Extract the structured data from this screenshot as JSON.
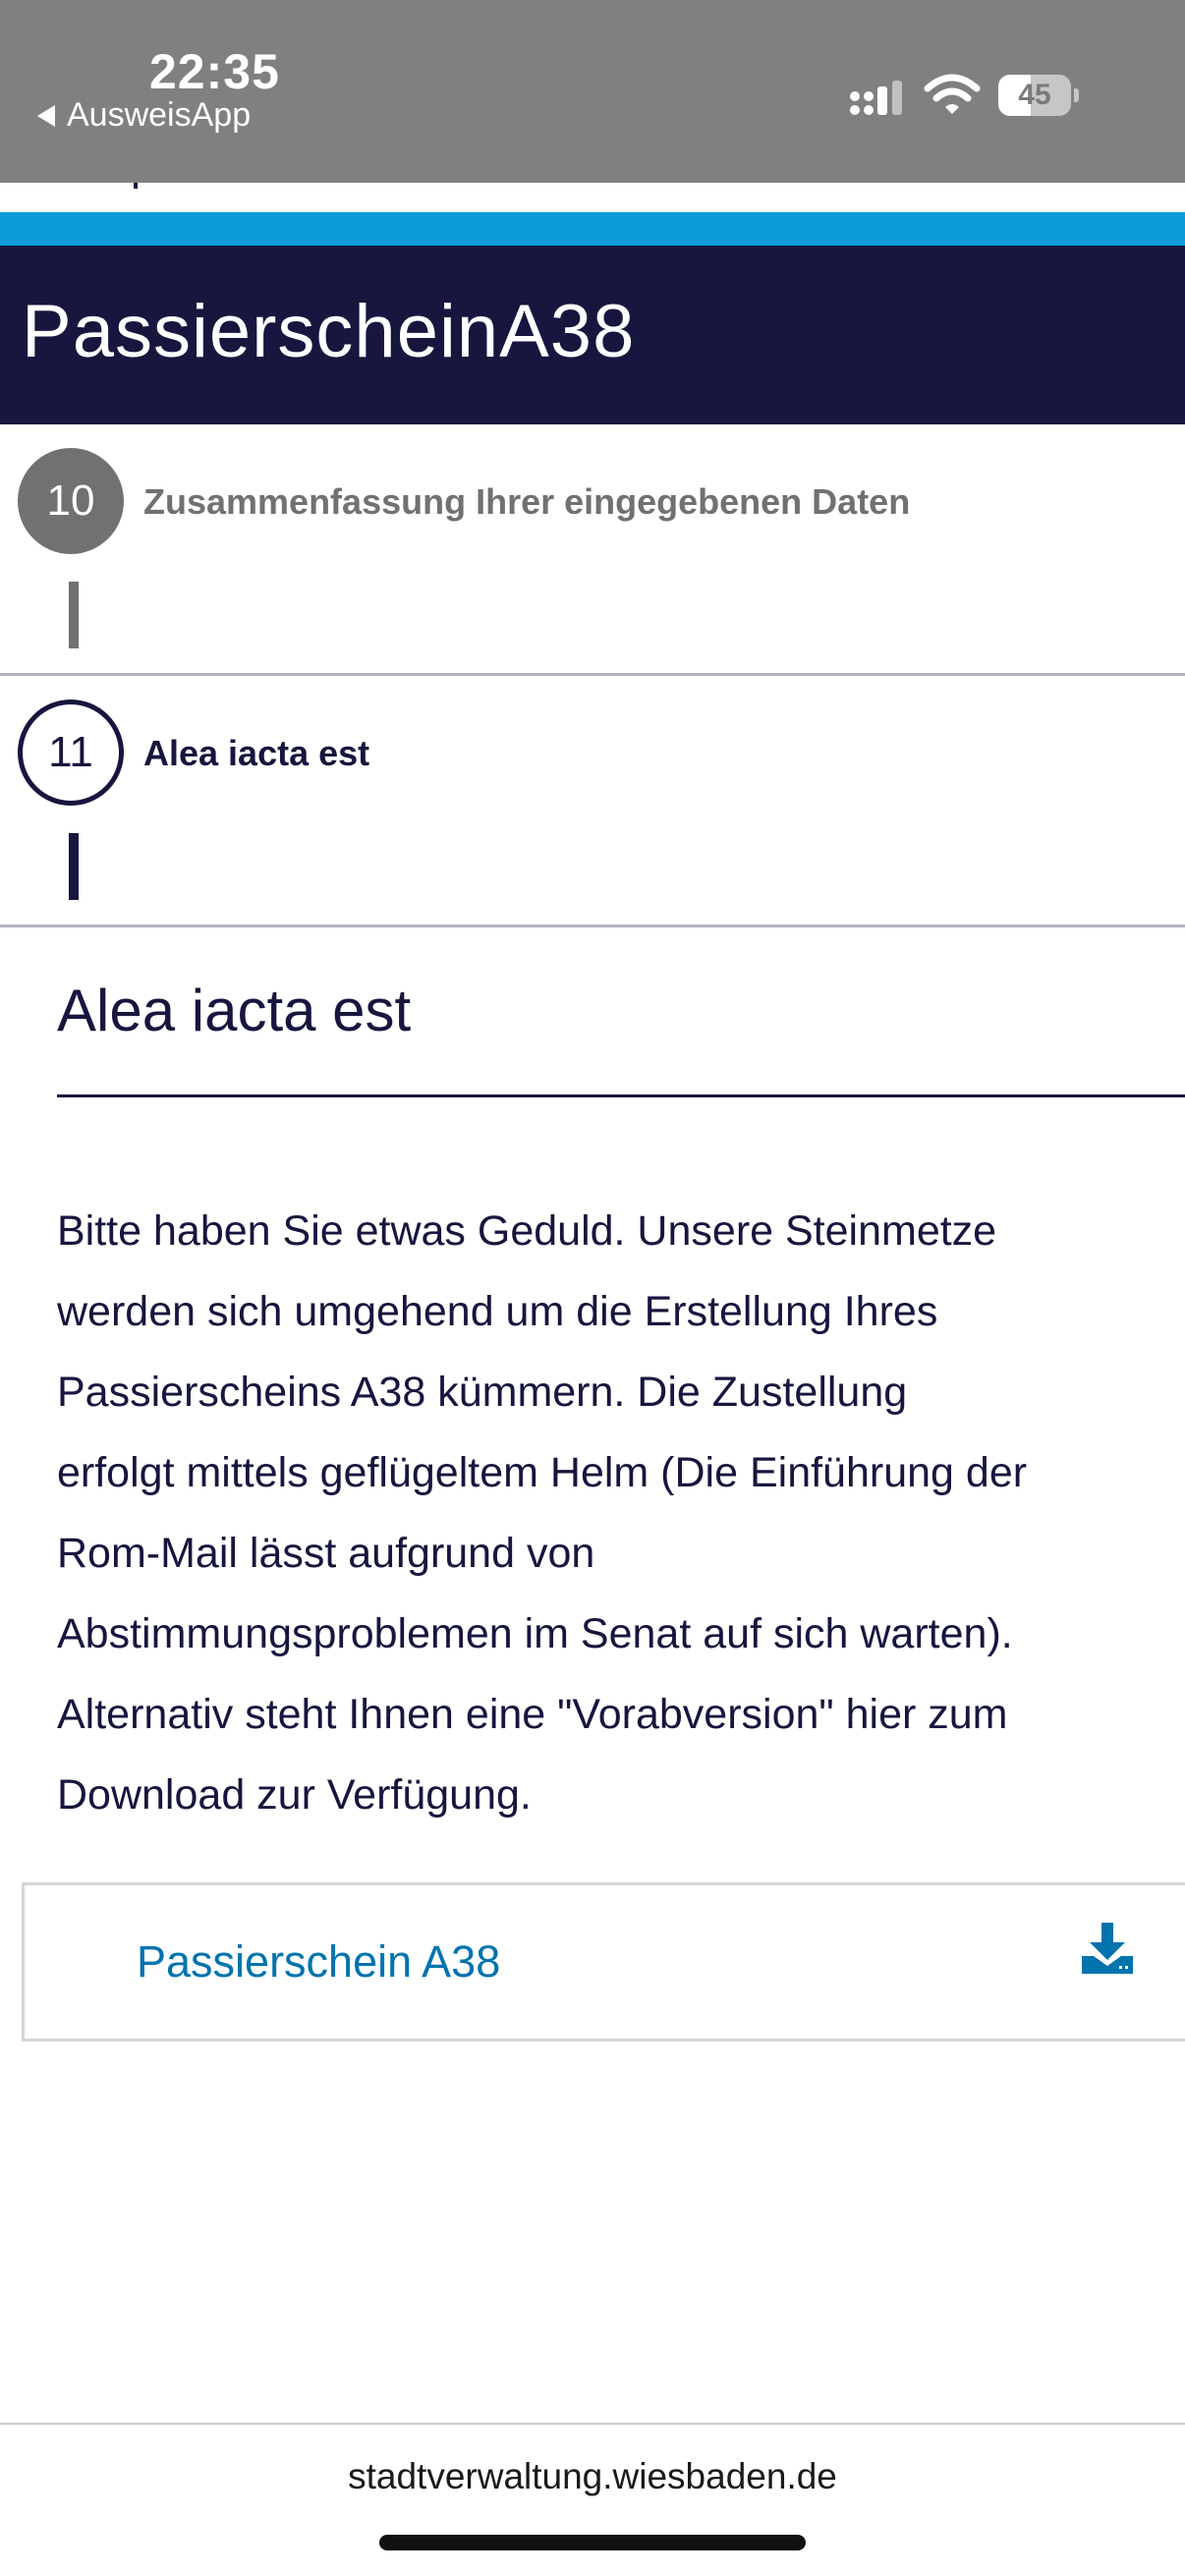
{
  "status_bar": {
    "time": "22:35",
    "back_label": "AusweisApp",
    "battery_level": "45",
    "battery_fraction": 0.45
  },
  "header": {
    "title": "PassierscheinA38"
  },
  "steps": [
    {
      "number": "10",
      "label": "Zusammenfassung Ihrer eingegebenen Daten",
      "state": "completed"
    },
    {
      "number": "11",
      "label": "Alea iacta est",
      "state": "active"
    }
  ],
  "content": {
    "title": "Alea iacta est",
    "body_lines": [
      "Bitte haben Sie etwas Geduld. Unsere Steinmetze",
      "werden sich umgehend um die Erstellung Ihres",
      "Passierscheins A38 kümmern. Die Zustellung",
      "erfolgt mittels geflügeltem Helm (Die Einführung der",
      "Rom-Mail lässt aufgrund von",
      "Abstimmungsproblemen im Senat auf sich warten).",
      "Alternativ steht Ihnen eine \"Vorabversion\" hier zum",
      "Download zur Verfügung."
    ],
    "download": {
      "label": "Passierschein A38",
      "icon": "download-icon"
    }
  },
  "footer": {
    "url": "stadtverwaltung.wiesbaden.de"
  },
  "colors": {
    "navy": "#16163f",
    "accent_blue": "#0b9bd7",
    "link_blue": "#0073ad",
    "gray": "#727070",
    "status_bar_gray": "#808080"
  }
}
